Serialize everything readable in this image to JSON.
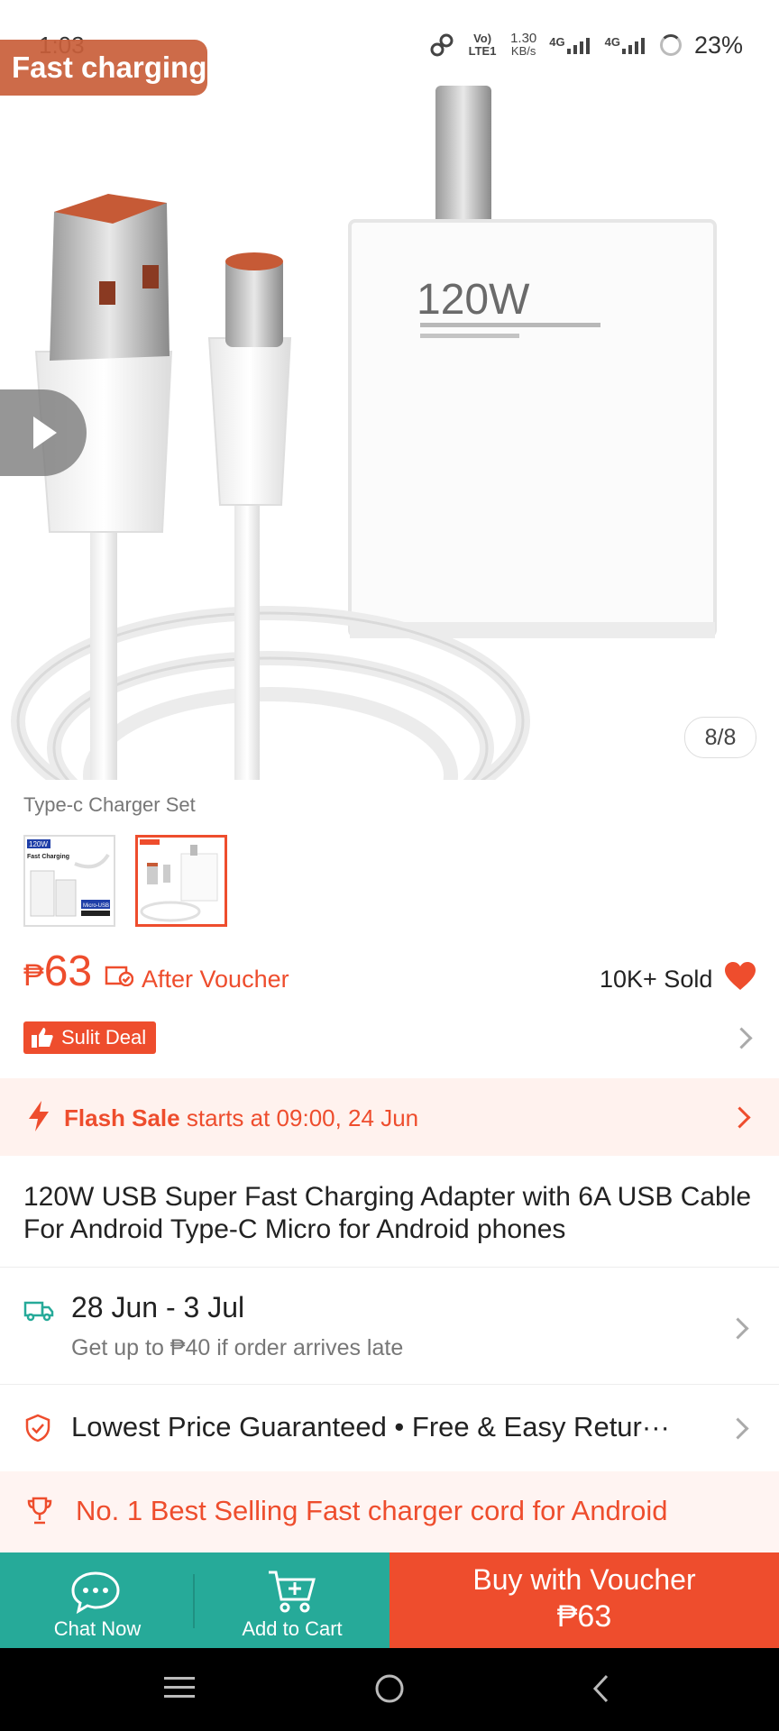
{
  "status_bar": {
    "time": "1:03",
    "volte": "Vo) LTE1",
    "speed_value": "1.30",
    "speed_unit": "KB/s",
    "net1": "4G",
    "net2": "4G",
    "battery": "23%"
  },
  "hero": {
    "badge": "Fast charging",
    "product_print": "120W",
    "counter": "8/8"
  },
  "variation": {
    "label": "Type-c Charger Set",
    "thumb1_badge": "120W",
    "thumb1_caption": "Fast Charging",
    "thumb1_sub": "Micro-USB"
  },
  "price": {
    "currency": "₱",
    "amount": "63",
    "after_voucher": "After Voucher",
    "sold": "10K+ Sold"
  },
  "sulit": {
    "label": "Sulit Deal"
  },
  "flash": {
    "bold": "Flash Sale",
    "rest": " starts at 09:00, 24 Jun"
  },
  "title": "120W USB Super Fast Charging Adapter with 6A USB Cable For Android Type-C Micro for Android phones",
  "shipping": {
    "date": "28 Jun - 3 Jul",
    "sub": "Get up to ₱40 if order arrives late"
  },
  "guarantee": {
    "text": "Lowest Price Guaranteed  •  Free & Easy Retur···"
  },
  "best_selling": {
    "text": "No. 1 Best Selling Fast charger cord for Android"
  },
  "action_bar": {
    "chat": "Chat Now",
    "cart": "Add to Cart",
    "buy_line1": "Buy with Voucher",
    "buy_line2": "₱63"
  },
  "colors": {
    "brand_orange": "#ee4d2d",
    "teal": "#26aa99",
    "flash_bg": "#fff2ee"
  }
}
